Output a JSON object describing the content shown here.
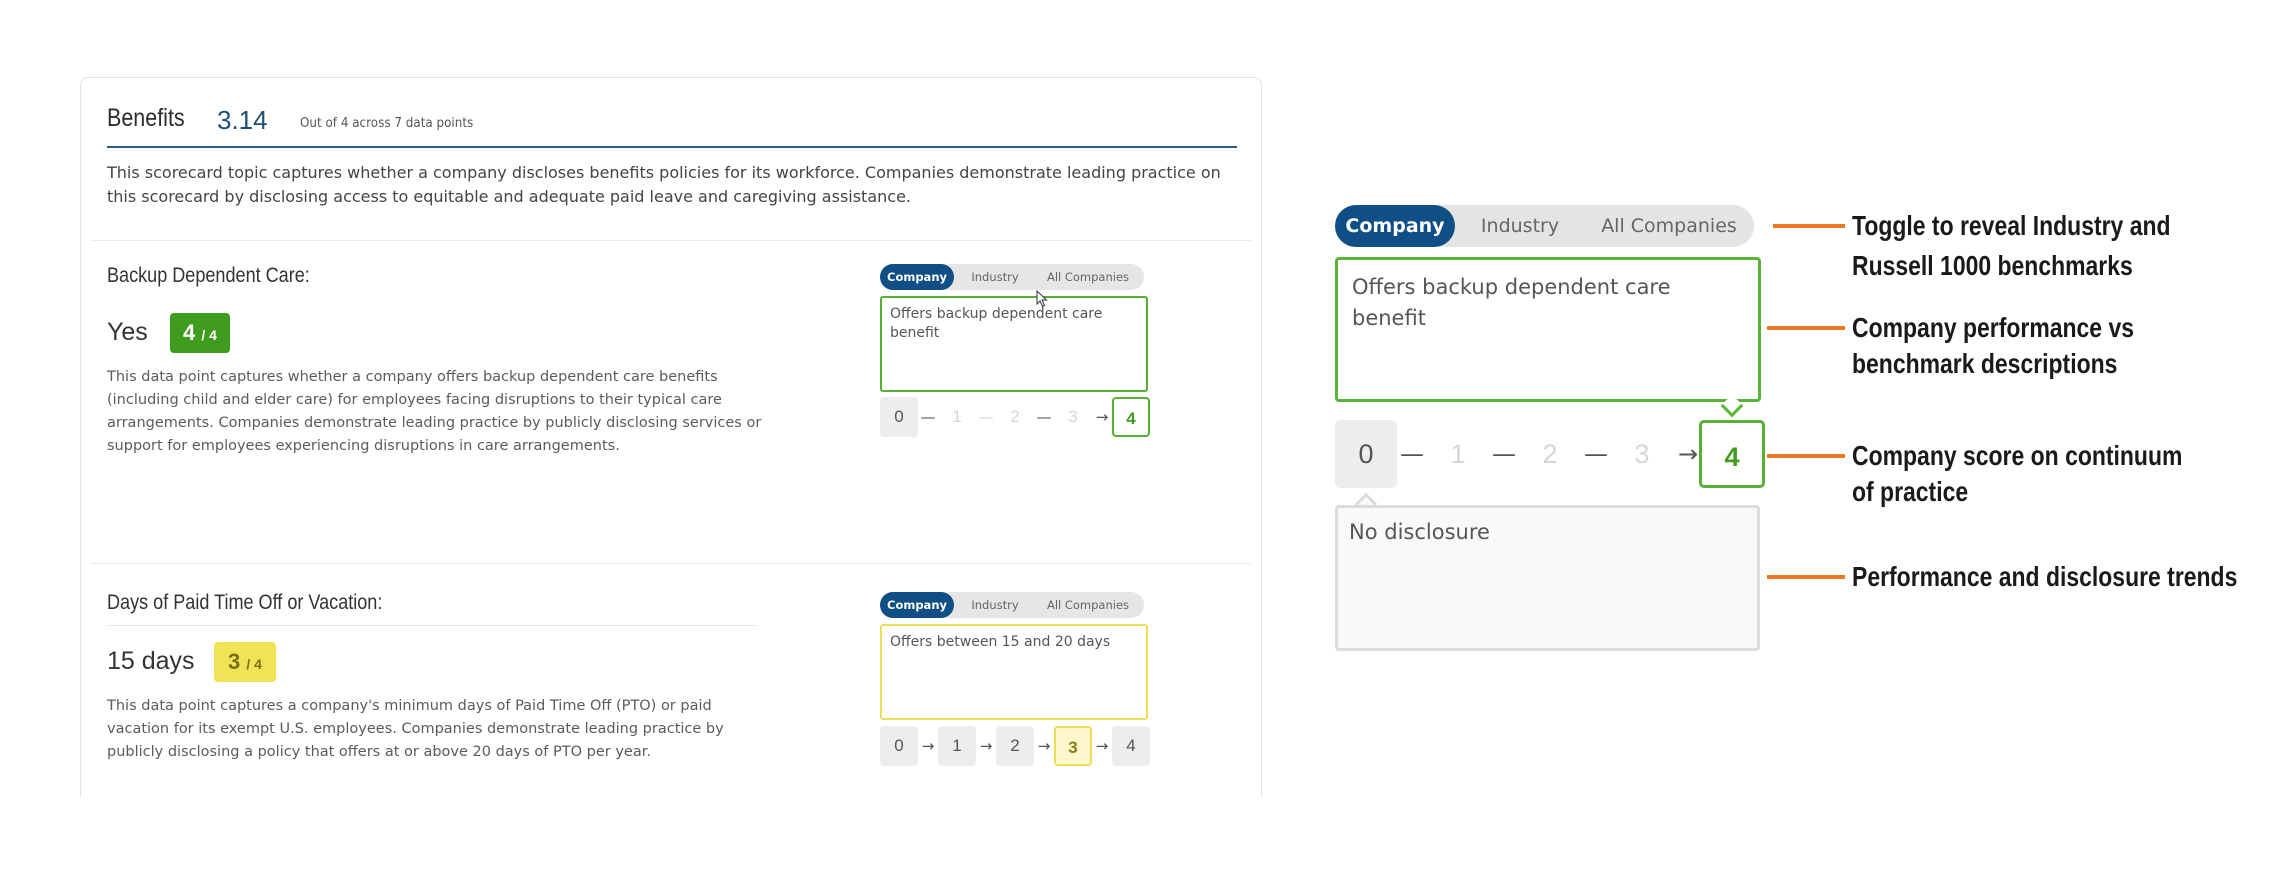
{
  "card": {
    "title": "Benefits",
    "score": "3.14",
    "score_sub": "Out of 4 across 7 data points",
    "description": "This scorecard topic captures whether a company discloses benefits policies for its workforce. Companies demonstrate leading practice on this scorecard by disclosing access to equitable and adequate paid leave and caregiving assistance."
  },
  "toggle": {
    "company": "Company",
    "industry": "Industry",
    "all": "All Companies"
  },
  "scale_numbers": [
    "0",
    "1",
    "2",
    "3",
    "4"
  ],
  "datapoints": [
    {
      "title": "Backup Dependent Care:",
      "value": "Yes",
      "badge_main": "4",
      "badge_sub": "/ 4",
      "description": "This data point captures whether a company offers backup dependent care benefits (including child and elder care) for employees facing disruptions to their typical care arrangements. Companies demonstrate leading practice by publicly disclosing services or support for employees experiencing disruptions in care arrangements.",
      "benchmark_text": "Offers backup dependent care benefit",
      "score": 4,
      "badge_color": "#3f9c1f"
    },
    {
      "title": "Days of Paid Time Off or Vacation:",
      "value": "15 days",
      "badge_main": "3",
      "badge_sub": "/ 4",
      "description": "This data point captures a company's minimum days of Paid Time Off (PTO) or paid vacation for its exempt U.S. employees. Companies demonstrate leading practice by publicly disclosing a policy that offers at or above 20 days of PTO per year.",
      "benchmark_text": "Offers between 15 and 20 days",
      "score": 3,
      "badge_color": "#f0e356"
    }
  ],
  "zoom": {
    "benchmark_text": "Offers backup dependent care benefit",
    "trend_text": "No disclosure"
  },
  "callouts": [
    "Toggle to reveal Industry and",
    "Russell 1000 benchmarks",
    "Company performance vs",
    "benchmark descriptions",
    "Company score on continuum",
    "of practice",
    "Performance and disclosure trends"
  ],
  "colors": {
    "accent_blue": "#0f4f85",
    "leading_green": "#3f9c1f",
    "mid_yellow": "#f0e356",
    "callout_orange": "#f07822"
  }
}
